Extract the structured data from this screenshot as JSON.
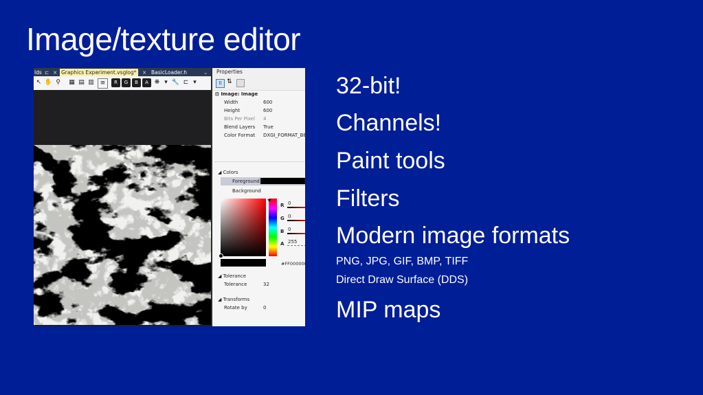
{
  "slide": {
    "title": "Image/texture editor",
    "bullets": [
      {
        "text": "32-bit!"
      },
      {
        "text": "Channels!"
      },
      {
        "text": "Paint tools"
      },
      {
        "text": "Filters"
      },
      {
        "text": "Modern image formats"
      }
    ],
    "sub_bullets": [
      {
        "text": "PNG, JPG, GIF, BMP, TIFF"
      },
      {
        "text": "Direct Draw Surface (DDS)"
      }
    ],
    "last_bullet": "MIP maps"
  },
  "editor": {
    "tabs": [
      {
        "label": "lds"
      },
      {
        "label": "Graphics Experiment.vsglog*"
      },
      {
        "label": "BasicLoader.h"
      }
    ],
    "tab_close": "×",
    "tab_pin": "⊏",
    "toolbar_icons": [
      "select-icon",
      "pan-icon",
      "zoom-icon",
      "toggle-icon",
      "grid-icon",
      "mip-icon",
      "frames-icon",
      "red-channel-icon",
      "green-channel-icon",
      "blue-channel-icon",
      "alpha-channel-icon",
      "pattern-icon",
      "wrench-icon",
      "transform-icon"
    ],
    "channel_letters": [
      "R",
      "G",
      "B",
      "A"
    ]
  },
  "properties": {
    "header": "Properties",
    "image_group": "Image: Image",
    "image_rows": [
      {
        "key": "Width",
        "value": "600"
      },
      {
        "key": "Height",
        "value": "600"
      },
      {
        "key": "Bits Per Pixel",
        "value": "4"
      },
      {
        "key": "Blend Layers",
        "value": "True"
      },
      {
        "key": "Color Format",
        "value": "DXGI_FORMAT_B8"
      }
    ],
    "colors_section": "Colors",
    "foreground_label": "Foreground",
    "background_label": "Background",
    "channels": [
      {
        "label": "R",
        "value": "0"
      },
      {
        "label": "G",
        "value": "0"
      },
      {
        "label": "B",
        "value": "0"
      },
      {
        "label": "A",
        "value": "255"
      }
    ],
    "hex_value": "#FF000000",
    "tolerance_section": "Tolerance",
    "tolerance_label": "Tolerance",
    "tolerance_value": "32",
    "transforms_section": "Transforms",
    "rotate_label": "Rotate by",
    "rotate_value": "0",
    "colors": {
      "foreground": "#000000",
      "picker_hue": "#ff0000"
    }
  }
}
